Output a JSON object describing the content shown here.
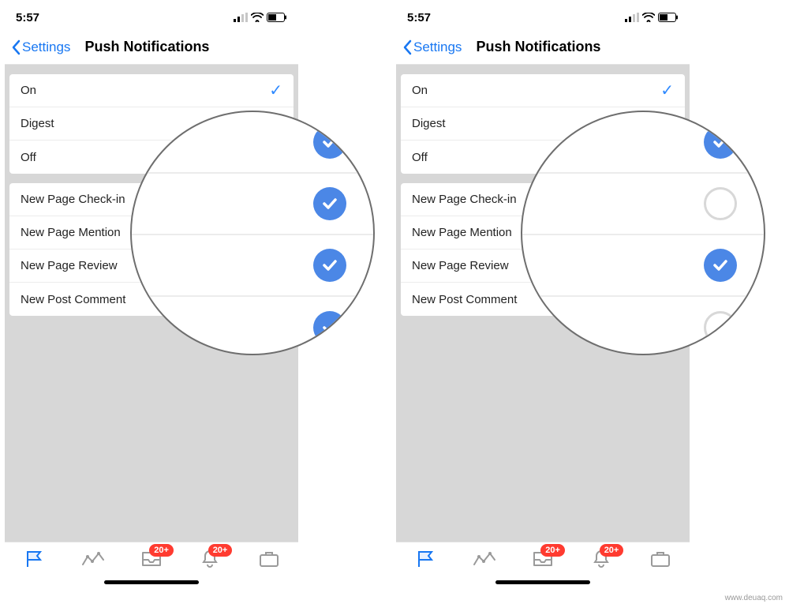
{
  "status": {
    "time": "5:57"
  },
  "nav": {
    "back_label": "Settings",
    "title": "Push Notifications"
  },
  "group1": {
    "on": {
      "label": "On",
      "checked": true
    },
    "digest": {
      "label": "Digest",
      "checked": false
    },
    "off": {
      "label": "Off",
      "checked": false
    }
  },
  "group2": {
    "checkin": {
      "label": "New Page Check-in"
    },
    "mention": {
      "label": "New Page Mention"
    },
    "review": {
      "label": "New Page Review"
    },
    "comment": {
      "label": "New Post Comment"
    }
  },
  "tabbar": {
    "badge_inbox": "20+",
    "badge_notifications": "20+"
  },
  "magnifier": {
    "left": {
      "states": [
        "on",
        "on",
        "on",
        "on"
      ]
    },
    "right": {
      "states": [
        "on",
        "off",
        "on",
        "off"
      ]
    }
  },
  "watermark": "www.deuaq.com"
}
